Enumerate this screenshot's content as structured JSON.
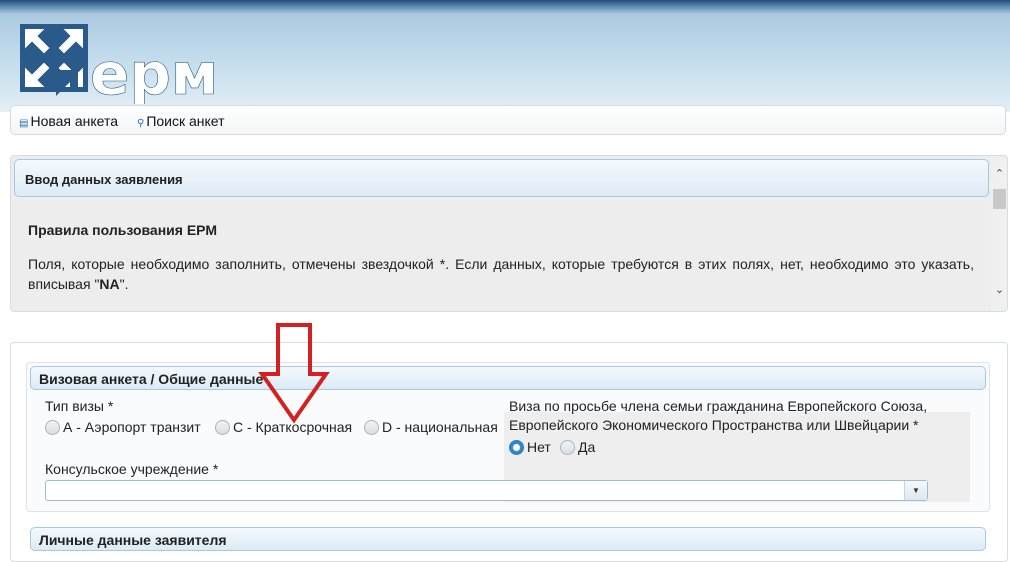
{
  "header": {
    "logo_text": "ерм",
    "colors": {
      "logo_blue": "#2a5a8a",
      "accent": "#2f86cc",
      "annotation_arrow": "#d42020"
    }
  },
  "nav": {
    "items": [
      {
        "label": "Новая анкета",
        "icon": "form-icon"
      },
      {
        "label": "Поиск анкет",
        "icon": "search-icon"
      }
    ]
  },
  "intro_panel": {
    "title": "Ввод данных заявления",
    "rules_title": "Правила пользования ЕРМ",
    "rules_text": "Поля, которые необходимо заполнить, отмечены звездочкой *. Если данных, которые требуются в этих полях, нет, необходимо это указать, вписывая \"",
    "rules_text_bold": "NA",
    "rules_text_end": "\"."
  },
  "form": {
    "section_title": "Визовая анкета / Общие данные",
    "visa_type": {
      "label": "Тип визы *",
      "options": [
        {
          "label": "А - Аэропорт транзит",
          "selected": false
        },
        {
          "label": "С - Краткосрочная",
          "selected": false
        },
        {
          "label": "D - национальная",
          "selected": false
        }
      ]
    },
    "family_member": {
      "label_line1": "Виза по просьбе члена семьи гражданина Европейского Союза,",
      "label_line2": "Европейского Экономического Пространства или Швейцарии *",
      "options": [
        {
          "label": "Нет",
          "selected": true
        },
        {
          "label": "Да",
          "selected": false
        }
      ]
    },
    "consulate": {
      "label": "Консульское учреждение *",
      "value": ""
    },
    "next_section_title": "Личные данные заявителя"
  }
}
